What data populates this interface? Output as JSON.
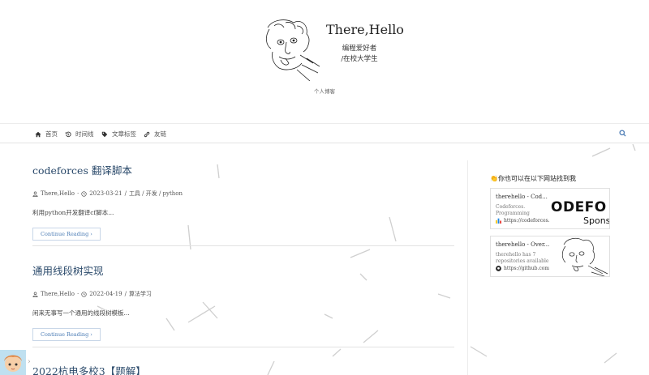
{
  "header": {
    "title": "There,Hello",
    "subtitle_line1": "编程爱好者",
    "subtitle_line2": "/在校大学生",
    "description": "个人博客"
  },
  "nav": {
    "items": [
      {
        "label": "首页",
        "icon": "home-icon"
      },
      {
        "label": "时间线",
        "icon": "history-icon"
      },
      {
        "label": "文章标签",
        "icon": "tag-icon"
      },
      {
        "label": "友链",
        "icon": "link-icon"
      }
    ],
    "search_icon": "search-icon"
  },
  "posts": [
    {
      "title": "codeforces 翻译脚本",
      "author": "There,Hello",
      "date": "2023-03-21",
      "categories": "工具 / 开发 / python",
      "excerpt": "利用python开发翻译cf脚本...",
      "more": "Continue Reading"
    },
    {
      "title": "通用线段树实现",
      "author": "There,Hello",
      "date": "2022-04-19",
      "categories": "算法学习",
      "excerpt": "闲来无事写一个通用的线段树模板...",
      "more": "Continue Reading"
    },
    {
      "title": "2022杭电多校3【题解】"
    }
  ],
  "sidebar": {
    "title": "👏你也可以在以下网站找到我",
    "cards": [
      {
        "title": "therehello - Cod...",
        "desc": "Codeforces. Programming",
        "url": "https://codeforces.co",
        "image_text": "ODEFO",
        "image_text2": "Spons"
      },
      {
        "title": "therehello - Over...",
        "desc": "therehello has 7 repositories available.",
        "url": "https://github.com/tr"
      }
    ]
  },
  "colors": {
    "accent": "#4a7bb4",
    "title": "#2b4a6b"
  }
}
